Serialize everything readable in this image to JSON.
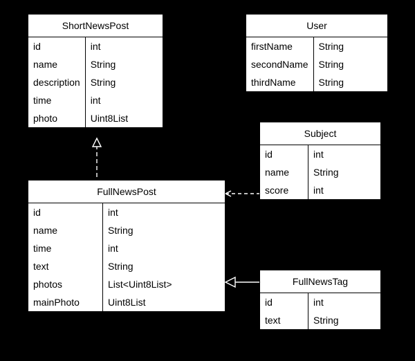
{
  "entities": {
    "shortNewsPost": {
      "title": "ShortNewsPost",
      "rows": [
        {
          "name": "id",
          "type": "int"
        },
        {
          "name": "name",
          "type": "String"
        },
        {
          "name": "description",
          "type": "String"
        },
        {
          "name": "time",
          "type": "int"
        },
        {
          "name": "photo",
          "type": "Uint8List"
        }
      ]
    },
    "user": {
      "title": "User",
      "rows": [
        {
          "name": "firstName",
          "type": "String"
        },
        {
          "name": "secondName",
          "type": "String"
        },
        {
          "name": "thirdName",
          "type": "String"
        }
      ]
    },
    "subject": {
      "title": "Subject",
      "rows": [
        {
          "name": "id",
          "type": "int"
        },
        {
          "name": "name",
          "type": "String"
        },
        {
          "name": "score",
          "type": "int"
        }
      ]
    },
    "fullNewsPost": {
      "title": "FullNewsPost",
      "rows": [
        {
          "name": "id",
          "type": "int"
        },
        {
          "name": "name",
          "type": "String"
        },
        {
          "name": "time",
          "type": "int"
        },
        {
          "name": "text",
          "type": "String"
        },
        {
          "name": "photos",
          "type": "List<Uint8List>"
        },
        {
          "name": "mainPhoto",
          "type": "Uint8List"
        }
      ]
    },
    "fullNewsTag": {
      "title": "FullNewsTag",
      "rows": [
        {
          "name": "id",
          "type": "int"
        },
        {
          "name": "text",
          "type": "String"
        }
      ]
    }
  }
}
